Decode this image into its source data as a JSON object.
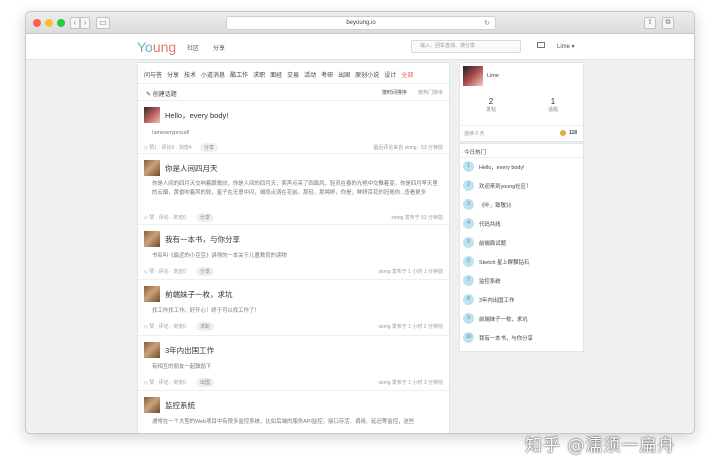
{
  "browser": {
    "url": "beyoung.io"
  },
  "site": {
    "logo_a": "Yo",
    "logo_b": "ung",
    "nav": [
      "社区",
      "分享"
    ],
    "search_placeholder": "输入、回车查询、搜分享",
    "user_menu": "Lime ▾"
  },
  "categories": [
    "问与答",
    "分享",
    "技术",
    "小道消息",
    "酷工作",
    "求职",
    "面经",
    "交易",
    "活动",
    "考研",
    "出国",
    "原创小说",
    "设计",
    "全部"
  ],
  "toolbar": {
    "create": "✎ 创建话题",
    "sort_time": "按时间排序",
    "sort_hot": "按热门排序"
  },
  "posts": [
    {
      "title": "Hello，every body!",
      "body": "Iameveryproud!",
      "meta": "◇ 赞1 · 评论0 · 浏览4",
      "tag": "分享",
      "info": "最后评论来自 xiong · 53 分钟前"
    },
    {
      "title": "你是人间四月天",
      "body": "你是人间的四月天交响着跟歌欣，你是人间的四月天，笑声点亮了四面风，轻灵在春的光艳中交舞着变。你是四月早天里的云烟，黄昏吹着风的软，星子在无意中闪，细雨点洒在花前。那轻，那娉婷，你是，鲜妍百花的冠冕你...查看更多",
      "meta": "◇ 赞 · 评论 · 浏览0",
      "tag": "分享",
      "info": "xiong 发布于 53 分钟前"
    },
    {
      "title": "我有一本书，与你分享",
      "body": "书名叫《最近的小豆豆》讲得的一本关于儿童教育的读物",
      "meta": "◇ 赞 · 评论 · 浏览0",
      "tag": "分享",
      "info": "xiong 发布于 1 小时 1 分钟前"
    },
    {
      "title": "前端妹子一枚，求坑",
      "body": "找工作找工作。好开心！终于可以找工作了！",
      "meta": "◇ 赞 · 评论 · 浏览0",
      "tag": "求职",
      "info": "xiong 发布于 1 小时 2 分钟前"
    },
    {
      "title": "3年内出国工作",
      "body": "有相互的朋友一起鼓励下",
      "meta": "◇ 赞 · 评论 · 浏览0",
      "tag": "出国",
      "info": "xiong 发布于 1 小时 3 分钟前"
    },
    {
      "title": "监控系统",
      "body": "通常在一个大型的Web项目中有很多监控系统，比如后端的服务API监控，接口存活、调用、延迟等监控，这些",
      "meta": "",
      "tag": "",
      "info": ""
    }
  ],
  "profile": {
    "name": "Lime",
    "stats": [
      {
        "num": "2",
        "label": "发帖"
      },
      {
        "num": "1",
        "label": "话题"
      }
    ],
    "signin": "连续 0 天",
    "coins": "118"
  },
  "hot": {
    "header": "今日热门",
    "items": [
      {
        "n": "1",
        "text": "Hello，every body!"
      },
      {
        "n": "2",
        "text": "欢迎来到young社区！"
      },
      {
        "n": "3",
        "text": "《叶，致敬》》"
      },
      {
        "n": "4",
        "text": "代码共线"
      },
      {
        "n": "5",
        "text": "前端面试题"
      },
      {
        "n": "6",
        "text": "Sketch 星上群飘钻石"
      },
      {
        "n": "7",
        "text": "监控系统"
      },
      {
        "n": "8",
        "text": "3年内出国工作"
      },
      {
        "n": "9",
        "text": "前端妹子一枚，求坑"
      },
      {
        "n": "10",
        "text": "我有一本书，与你分享"
      }
    ]
  },
  "watermark": "知乎 @濡须一扁舟"
}
